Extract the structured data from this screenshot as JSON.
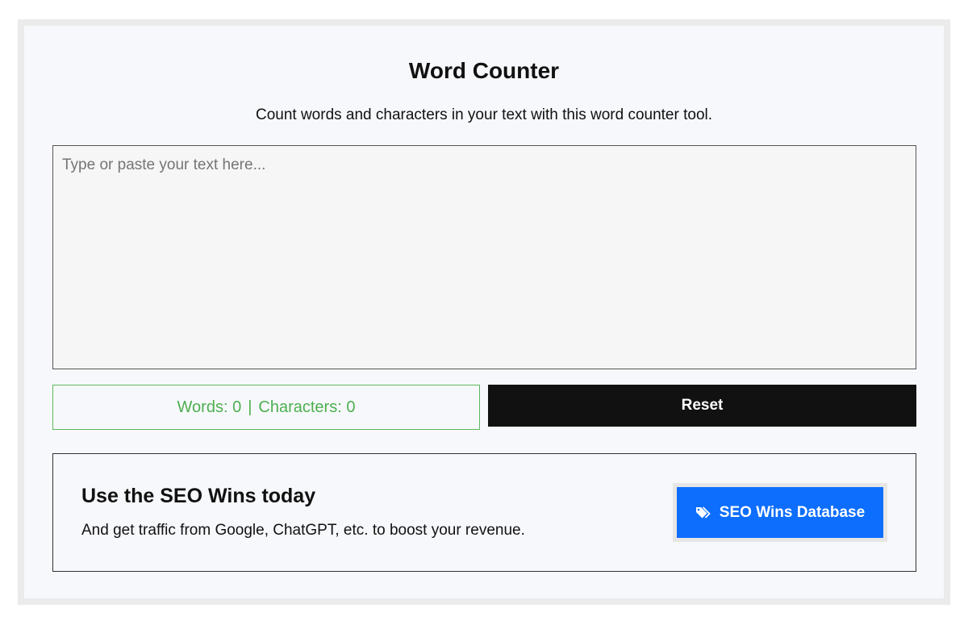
{
  "header": {
    "title": "Word Counter",
    "subtitle": "Count words and characters in your text with this word counter tool."
  },
  "editor": {
    "placeholder": "Type or paste your text here...",
    "value": ""
  },
  "stats": {
    "words_label": "Words: 0",
    "separator": "|",
    "characters_label": "Characters: 0"
  },
  "actions": {
    "reset_label": "Reset"
  },
  "promo": {
    "heading": "Use the SEO Wins today",
    "text": "And get traffic from Google, ChatGPT, etc. to boost your revenue.",
    "button_label": "SEO Wins Database",
    "button_icon": "tags-icon"
  },
  "colors": {
    "accent_blue": "#0d6efd",
    "counter_green": "#4caf50",
    "reset_black": "#111111"
  }
}
